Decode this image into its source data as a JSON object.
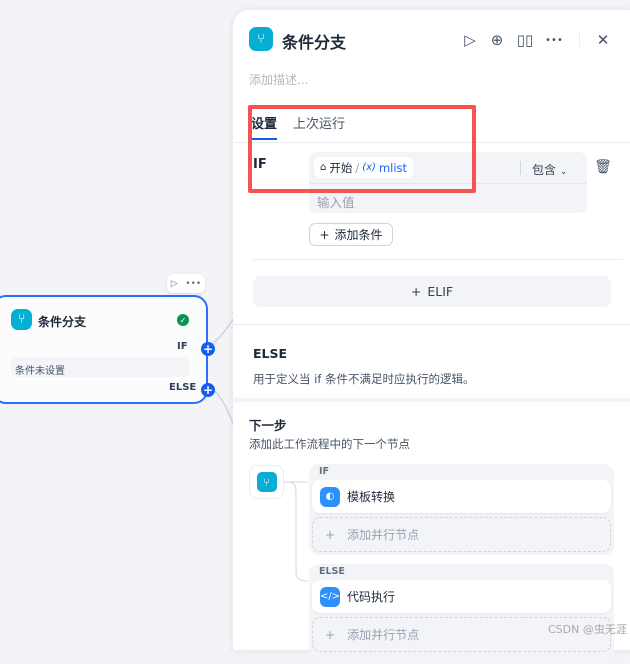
{
  "canvas_node": {
    "title": "条件分支",
    "if_label": "IF",
    "condition_text": "条件未设置",
    "else_label": "ELSE"
  },
  "panel": {
    "title": "条件分支",
    "description_placeholder": "添加描述...",
    "tabs": [
      {
        "label": "设置",
        "active": true
      },
      {
        "label": "上次运行",
        "active": false
      }
    ],
    "if_section": {
      "label": "IF",
      "variable_source": "开始",
      "variable_separator": "/",
      "variable_prefix": "(x)",
      "variable_name": "mlist",
      "operator": "包含",
      "value_placeholder": "输入值",
      "add_condition": "添加条件"
    },
    "elif_button": "ELIF",
    "else_section": {
      "title": "ELSE",
      "description": "用于定义当 if 条件不满足时应执行的逻辑。"
    },
    "next_step": {
      "title": "下一步",
      "description": "添加此工作流程中的下一个节点",
      "branches": [
        {
          "label": "IF",
          "node": "模板转换",
          "add_parallel": "添加并行节点"
        },
        {
          "label": "ELSE",
          "node": "代码执行",
          "add_parallel": "添加并行节点"
        }
      ]
    }
  },
  "watermark": "CSDN @虫无涯",
  "colors": {
    "accent": "#155eef",
    "highlight": "#f55353",
    "node_icon": "#06aed4"
  }
}
